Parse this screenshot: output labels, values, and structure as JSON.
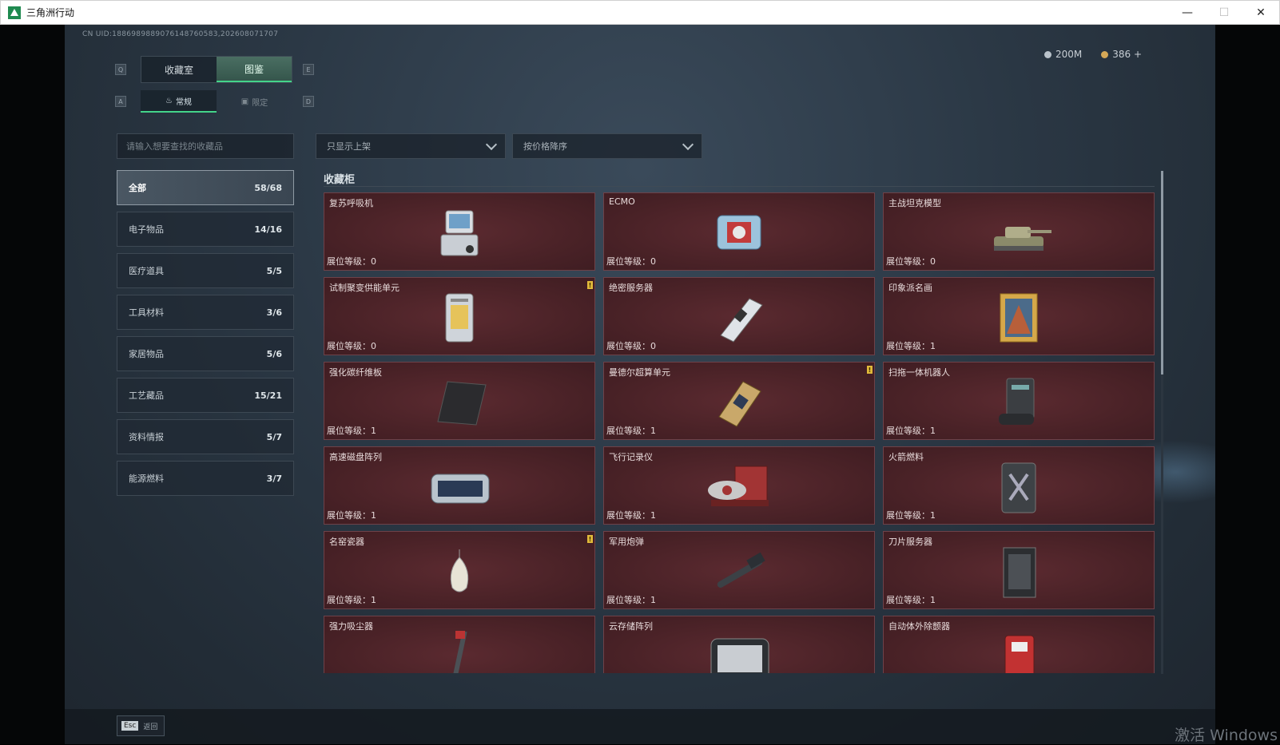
{
  "window": {
    "title": "三角洲行动",
    "minimize": "—",
    "maximize": "☐",
    "close": "✕"
  },
  "uid": "CN UID:1886989889076148760583,202608071707",
  "currency": {
    "silver": "200M",
    "gold": "386 +"
  },
  "keyhints": {
    "q": "Q",
    "e": "E",
    "a": "A",
    "d": "D"
  },
  "tabs": {
    "collection_room": "收藏室",
    "catalog": "图鉴"
  },
  "subtabs": {
    "regular": "常规",
    "limited": "限定"
  },
  "search": {
    "placeholder": "请输入想要查找的收藏品"
  },
  "categories": [
    {
      "label": "全部",
      "count": "58/68"
    },
    {
      "label": "电子物品",
      "count": "14/16"
    },
    {
      "label": "医疗道具",
      "count": "5/5"
    },
    {
      "label": "工具材料",
      "count": "3/6"
    },
    {
      "label": "家居物品",
      "count": "5/6"
    },
    {
      "label": "工艺藏品",
      "count": "15/21"
    },
    {
      "label": "资料情报",
      "count": "5/7"
    },
    {
      "label": "能源燃料",
      "count": "3/7"
    }
  ],
  "filters": {
    "shelf": "只显示上架",
    "sort": "按价格降序"
  },
  "section_title": "收藏柜",
  "level_label": "展位等级：",
  "badge_glyph": "!",
  "items": [
    {
      "name": "复苏呼吸机",
      "level": "0",
      "badge": false,
      "icon": "ventilator-icon"
    },
    {
      "name": "ECMO",
      "level": "0",
      "badge": false,
      "icon": "ecmo-icon"
    },
    {
      "name": "主战坦克模型",
      "level": "0",
      "badge": false,
      "icon": "tank-model-icon"
    },
    {
      "name": "试制聚变供能单元",
      "level": "0",
      "badge": true,
      "icon": "fusion-unit-icon"
    },
    {
      "name": "绝密服务器",
      "level": "0",
      "badge": false,
      "icon": "server-icon"
    },
    {
      "name": "印象派名画",
      "level": "1",
      "badge": false,
      "icon": "painting-icon"
    },
    {
      "name": "强化碳纤维板",
      "level": "1",
      "badge": false,
      "icon": "carbon-plate-icon"
    },
    {
      "name": "曼德尔超算单元",
      "level": "1",
      "badge": true,
      "icon": "supercomputer-icon"
    },
    {
      "name": "扫拖一体机器人",
      "level": "1",
      "badge": false,
      "icon": "robot-vacuum-icon"
    },
    {
      "name": "高速磁盘阵列",
      "level": "1",
      "badge": false,
      "icon": "disk-array-icon"
    },
    {
      "name": "飞行记录仪",
      "level": "1",
      "badge": false,
      "icon": "flight-recorder-icon"
    },
    {
      "name": "火箭燃料",
      "level": "1",
      "badge": false,
      "icon": "fuel-can-icon"
    },
    {
      "name": "名窑瓷器",
      "level": "1",
      "badge": true,
      "icon": "porcelain-vase-icon"
    },
    {
      "name": "军用炮弹",
      "level": "1",
      "badge": false,
      "icon": "artillery-shell-icon"
    },
    {
      "name": "刀片服务器",
      "level": "1",
      "badge": false,
      "icon": "blade-server-icon"
    },
    {
      "name": "强力吸尘器",
      "level": "",
      "badge": false,
      "icon": "vacuum-cleaner-icon"
    },
    {
      "name": "云存储阵列",
      "level": "",
      "badge": false,
      "icon": "cloud-storage-icon"
    },
    {
      "name": "自动体外除颤器",
      "level": "",
      "badge": false,
      "icon": "defibrillator-icon"
    }
  ],
  "footer": {
    "esc_key": "Esc",
    "esc_label": "返回"
  },
  "watermark": "激活 Windows"
}
